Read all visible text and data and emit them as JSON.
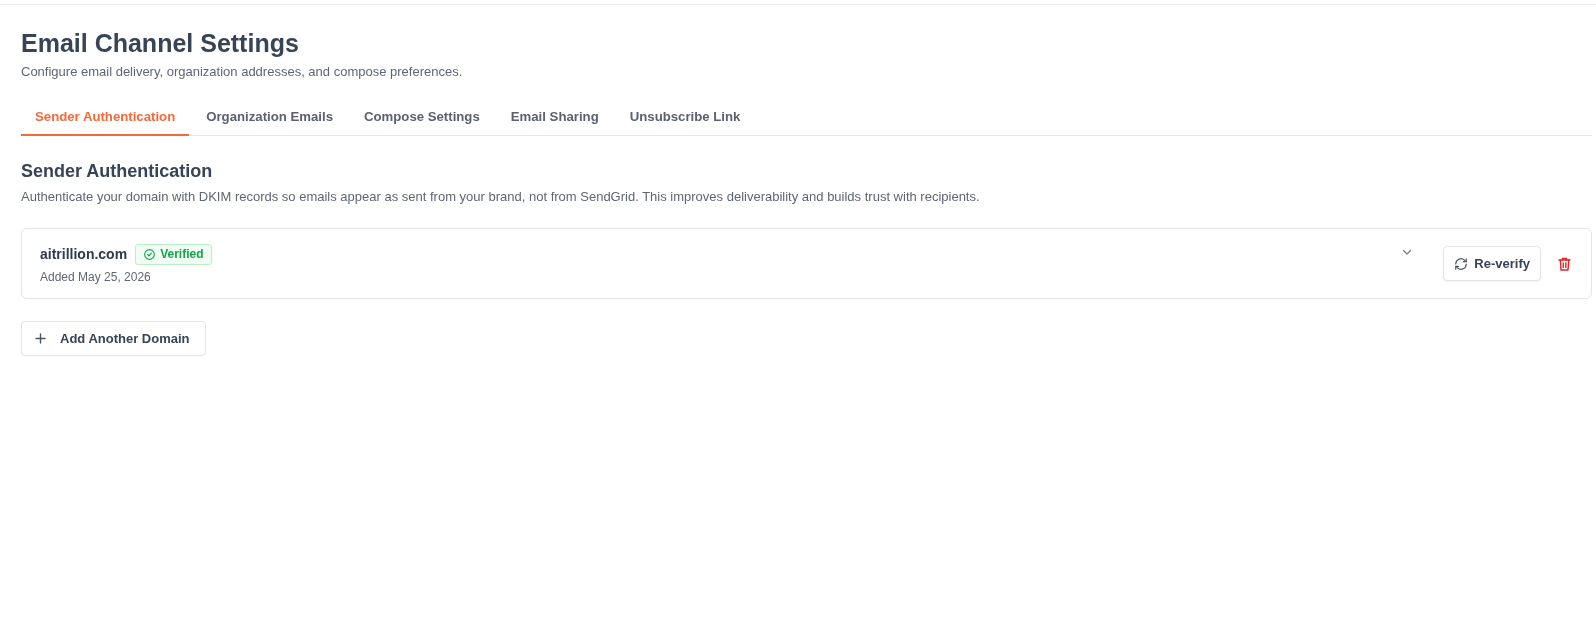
{
  "header": {
    "title": "Email Channel Settings",
    "subtitle": "Configure email delivery, organization addresses, and compose preferences."
  },
  "tabs": [
    {
      "label": "Sender Authentication",
      "selected": true
    },
    {
      "label": "Organization Emails",
      "selected": false
    },
    {
      "label": "Compose Settings",
      "selected": false
    },
    {
      "label": "Email Sharing",
      "selected": false
    },
    {
      "label": "Unsubscribe Link",
      "selected": false
    }
  ],
  "section": {
    "title": "Sender Authentication",
    "description": "Authenticate your domain with DKIM records so emails appear as sent from your brand, not from SendGrid. This improves deliverability and builds trust with recipients."
  },
  "domains": [
    {
      "domain": "aitrillion.com",
      "verified": true,
      "status_label": "Verified",
      "added": "Added May 25, 2026",
      "expanded": false,
      "action": "Re-verify"
    }
  ],
  "add_button": "Add Another Domain"
}
